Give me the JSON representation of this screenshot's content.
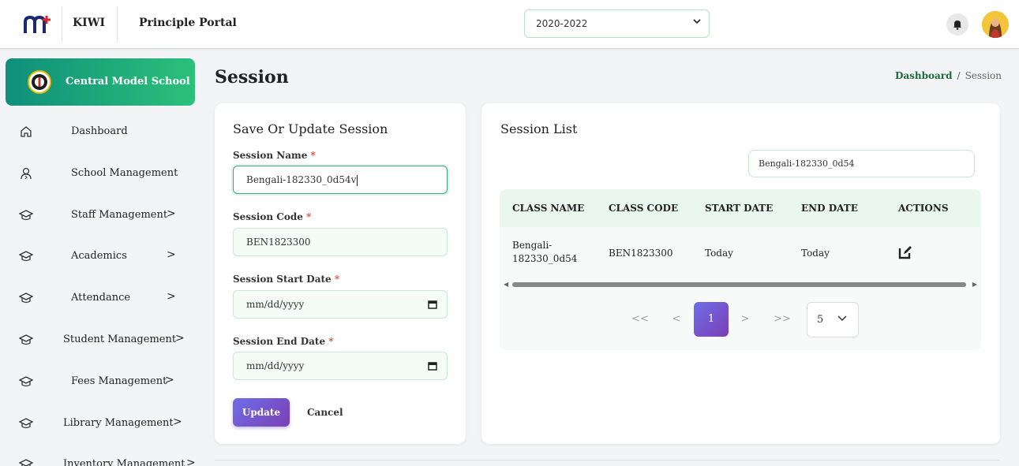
{
  "header": {
    "brand": "KIWI",
    "portal": "Principle Portal",
    "year_select": "2020-2022"
  },
  "sidebar": {
    "school_name": "Central Model School",
    "items": [
      {
        "label": "Dashboard",
        "icon": "home-icon",
        "chevron": ""
      },
      {
        "label": "School Management",
        "icon": "user-icon",
        "chevron": ""
      },
      {
        "label": "Staff Management",
        "icon": "graduation-cap-icon",
        "chevron": ">"
      },
      {
        "label": "Academics",
        "icon": "graduation-cap-icon",
        "chevron": ">"
      },
      {
        "label": "Attendance",
        "icon": "graduation-cap-icon",
        "chevron": ">"
      },
      {
        "label": "Student Management",
        "icon": "graduation-cap-icon",
        "chevron": ">"
      },
      {
        "label": "Fees Management",
        "icon": "graduation-cap-icon",
        "chevron": ">"
      },
      {
        "label": "Library Management",
        "icon": "graduation-cap-icon",
        "chevron": ">"
      },
      {
        "label": "Inventory Management",
        "icon": "graduation-cap-icon",
        "chevron": ">"
      }
    ]
  },
  "page": {
    "title": "Session",
    "breadcrumb_home": "Dashboard",
    "breadcrumb_sep": "/",
    "breadcrumb_current": "Session"
  },
  "form": {
    "title": "Save Or Update Session",
    "name_label": "Session Name",
    "name_value": "Bengali-182330_0d54v",
    "code_label": "Session Code",
    "code_value": "BEN1823300",
    "start_label": "Session Start Date",
    "start_value": "mm/dd/yyyy",
    "end_label": "Session End Date",
    "end_value": "mm/dd/yyyy",
    "required_mark": "*",
    "update_label": "Update",
    "cancel_label": "Cancel"
  },
  "list": {
    "title": "Session List",
    "search_value": "Bengali-182330_0d54",
    "columns": [
      "CLASS NAME",
      "CLASS CODE",
      "START DATE",
      "END DATE",
      "ACTIONS"
    ],
    "rows": [
      {
        "class_name_1": "Bengali-",
        "class_name_2": "182330_0d54",
        "class_code": "BEN1823300",
        "start_date": "Today",
        "end_date": "Today"
      }
    ],
    "pagination": {
      "first": "<<",
      "prev": "<",
      "current": "1",
      "next": ">",
      "last": ">>",
      "page_size": "5"
    }
  },
  "colors": {
    "accent_green": "#2cc07a",
    "accent_purple": "#6e6ee8",
    "brand_red": "#d8262c"
  }
}
